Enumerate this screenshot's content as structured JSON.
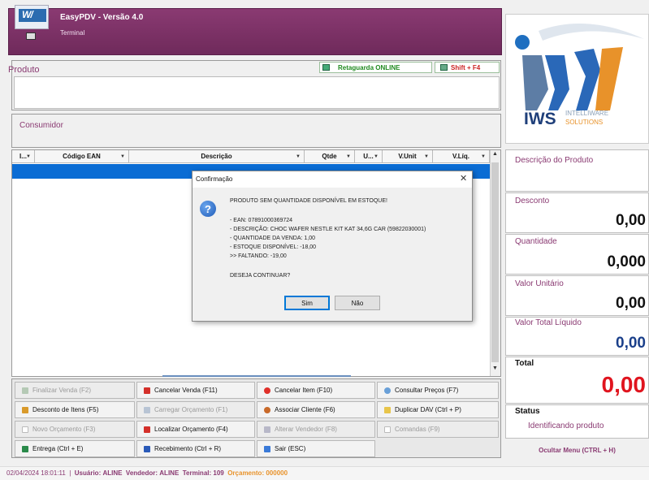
{
  "header": {
    "title": "EasyPDV - Versão 4.0",
    "subtitle": "Terminal"
  },
  "produto": {
    "label": "Produto",
    "retaguarda": "Retaguarda ONLINE",
    "shift": "Shift + F4"
  },
  "consumidor": {
    "label": "Consumidor"
  },
  "grid": {
    "columns": [
      "I...",
      "Código EAN",
      "Descrição",
      "Qtde",
      "U...",
      "V.Unit",
      "V.Líq."
    ]
  },
  "dialog": {
    "title": "Confirmação",
    "heading": "PRODUTO SEM QUANTIDADE DISPONÍVEL EM ESTOQUE!",
    "lines": [
      "- EAN: 07891000369724",
      "- DESCRIÇÃO: CHOC WAFER NESTLE KIT KAT 34,6G CAR (59822030001)",
      "- QUANTIDADE DA VENDA: 1,00",
      "- ESTOQUE DISPONÍVEL: -18,00",
      ">> FALTANDO: -19,00"
    ],
    "question": "DESEJA CONTINUAR?",
    "yes": "Sim",
    "no": "Não"
  },
  "buttons": {
    "finalizar": "Finalizar Venda (F2)",
    "cancelar_venda": "Cancelar Venda (F11)",
    "cancelar_item": "Cancelar Item (F10)",
    "consultar": "Consultar Preços (F7)",
    "desconto": "Desconto de Itens (F5)",
    "carregar": "Carregar Orçamento (F1)",
    "associar": "Associar Cliente (F6)",
    "duplicar": "Duplicar DAV (Ctrl + P)",
    "novo": "Novo Orçamento (F3)",
    "localizar": "Localizar Orçamento (F4)",
    "alterar": "Alterar Vendedor (F8)",
    "comandas": "Comandas (F9)",
    "entrega": "Entrega (Ctrl + E)",
    "recebimento": "Recebimento (Ctrl + R)",
    "sair": "Sair (ESC)"
  },
  "brand": {
    "name": "IWS",
    "line1": "INTELLIWARE",
    "line2": "SOLUTIONS"
  },
  "right": {
    "descricao_label": "Descrição do Produto",
    "desconto_label": "Desconto",
    "desconto_value": "0,00",
    "quantidade_label": "Quantidade",
    "quantidade_value": "0,000",
    "unitario_label": "Valor Unitário",
    "unitario_value": "0,00",
    "total_liq_label": "Valor Total Líquido",
    "total_liq_value": "0,00",
    "total_label": "Total",
    "total_value": "0,00",
    "status_label": "Status",
    "status_value": "Identificando produto",
    "ocultar": "Ocultar Menu (CTRL + H)"
  },
  "statusbar": {
    "datetime": "02/04/2024 18:01:11",
    "usuario_label": "Usuário:",
    "usuario": "ALINE",
    "vendedor_label": "Vendedor:",
    "vendedor": "ALINE",
    "terminal_label": "Terminal:",
    "terminal": "109",
    "orcamento_label": "Orçamento:",
    "orcamento": "000000"
  },
  "colors": {
    "brand_purple": "#8a3a72",
    "selection_blue": "#0a6cd4",
    "total_red": "#e0141e",
    "liquid_blue": "#1a3f8a"
  }
}
